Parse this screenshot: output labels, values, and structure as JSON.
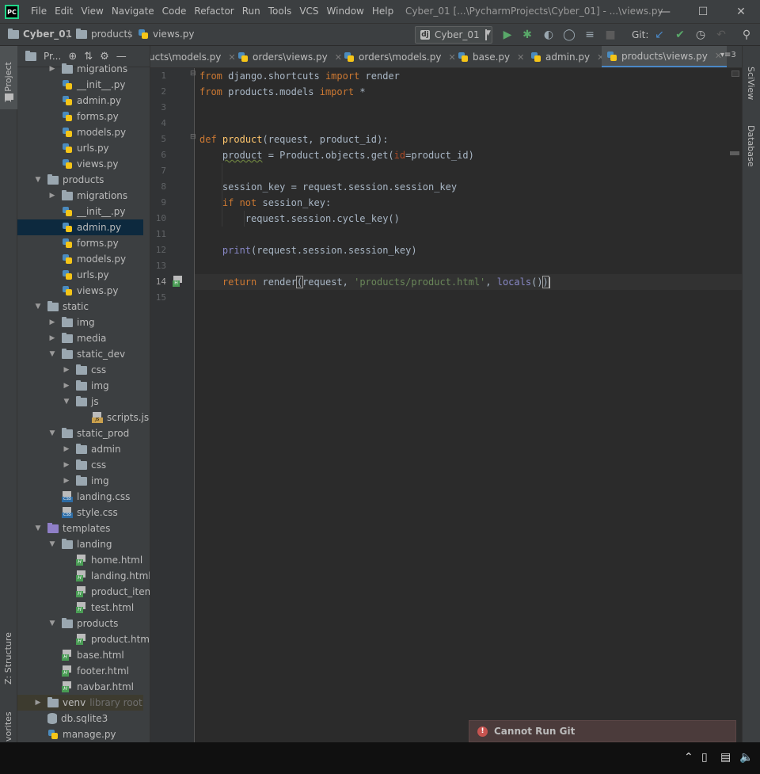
{
  "window": {
    "logo": "PC",
    "title": "Cyber_01 [...\\PycharmProjects\\Cyber_01] - ...\\views.py",
    "menu": [
      "File",
      "Edit",
      "View",
      "Navigate",
      "Code",
      "Refactor",
      "Run",
      "Tools",
      "VCS",
      "Window",
      "Help"
    ]
  },
  "navbar": {
    "breadcrumb": [
      "Cyber_01",
      "products",
      "views.py"
    ],
    "run_config": "Cyber_01",
    "run_config_icon": "dj",
    "git_label": "Git:"
  },
  "left_tools": {
    "project": "1: Project",
    "structure": "Z: Structure",
    "favorites": "vorites"
  },
  "right_tools": {
    "sciview": "SciView",
    "database": "Database"
  },
  "project_panel": {
    "title": "Pr...",
    "tree": [
      {
        "label": "migrations",
        "type": "folder",
        "depth": 1,
        "arrow": "right"
      },
      {
        "label": "__init__.py",
        "type": "py",
        "depth": 1
      },
      {
        "label": "admin.py",
        "type": "py",
        "depth": 1
      },
      {
        "label": "forms.py",
        "type": "py",
        "depth": 1
      },
      {
        "label": "models.py",
        "type": "py",
        "depth": 1
      },
      {
        "label": "urls.py",
        "type": "py",
        "depth": 1
      },
      {
        "label": "views.py",
        "type": "py",
        "depth": 1
      },
      {
        "label": "products",
        "type": "folder",
        "depth": 0,
        "arrow": "down"
      },
      {
        "label": "migrations",
        "type": "folder",
        "depth": 1,
        "arrow": "right"
      },
      {
        "label": "__init__.py",
        "type": "py",
        "depth": 1
      },
      {
        "label": "admin.py",
        "type": "py",
        "depth": 1,
        "selected": true
      },
      {
        "label": "forms.py",
        "type": "py",
        "depth": 1
      },
      {
        "label": "models.py",
        "type": "py",
        "depth": 1
      },
      {
        "label": "urls.py",
        "type": "py",
        "depth": 1
      },
      {
        "label": "views.py",
        "type": "py",
        "depth": 1
      },
      {
        "label": "static",
        "type": "folder",
        "depth": 0,
        "arrow": "down"
      },
      {
        "label": "img",
        "type": "folder",
        "depth": 1,
        "arrow": "right"
      },
      {
        "label": "media",
        "type": "folder",
        "depth": 1,
        "arrow": "right"
      },
      {
        "label": "static_dev",
        "type": "folder",
        "depth": 1,
        "arrow": "down"
      },
      {
        "label": "css",
        "type": "folder",
        "depth": 2,
        "arrow": "right"
      },
      {
        "label": "img",
        "type": "folder",
        "depth": 2,
        "arrow": "right"
      },
      {
        "label": "js",
        "type": "folder",
        "depth": 2,
        "arrow": "down"
      },
      {
        "label": "scripts.js",
        "type": "js",
        "depth": 3
      },
      {
        "label": "static_prod",
        "type": "folder",
        "depth": 1,
        "arrow": "down"
      },
      {
        "label": "admin",
        "type": "folder",
        "depth": 2,
        "arrow": "right"
      },
      {
        "label": "css",
        "type": "folder",
        "depth": 2,
        "arrow": "right"
      },
      {
        "label": "img",
        "type": "folder",
        "depth": 2,
        "arrow": "right"
      },
      {
        "label": "landing.css",
        "type": "css",
        "depth": 1
      },
      {
        "label": "style.css",
        "type": "css",
        "depth": 1
      },
      {
        "label": "templates",
        "type": "tpl",
        "depth": 0,
        "arrow": "down"
      },
      {
        "label": "landing",
        "type": "folder",
        "depth": 1,
        "arrow": "down"
      },
      {
        "label": "home.html",
        "type": "html",
        "depth": 2
      },
      {
        "label": "landing.html",
        "type": "html",
        "depth": 2
      },
      {
        "label": "product_item.html",
        "type": "html",
        "depth": 2
      },
      {
        "label": "test.html",
        "type": "html",
        "depth": 2
      },
      {
        "label": "products",
        "type": "folder",
        "depth": 1,
        "arrow": "down"
      },
      {
        "label": "product.html",
        "type": "html",
        "depth": 2
      },
      {
        "label": "base.html",
        "type": "html",
        "depth": 1
      },
      {
        "label": "footer.html",
        "type": "html",
        "depth": 1
      },
      {
        "label": "navbar.html",
        "type": "html",
        "depth": 1
      },
      {
        "label": "venv",
        "type": "folder",
        "depth": 0,
        "arrow": "right",
        "extra": "library root",
        "lib": true
      },
      {
        "label": "db.sqlite3",
        "type": "db",
        "depth": 0
      },
      {
        "label": "manage.py",
        "type": "py",
        "depth": 0
      }
    ]
  },
  "tabs": [
    {
      "label": "ucts\\models.py",
      "icon": "none"
    },
    {
      "label": "orders\\views.py",
      "icon": "py"
    },
    {
      "label": "orders\\models.py",
      "icon": "py"
    },
    {
      "label": "base.py",
      "icon": "py"
    },
    {
      "label": "admin.py",
      "icon": "py"
    },
    {
      "label": "products\\views.py",
      "icon": "py",
      "active": true
    }
  ],
  "tab_overflow": "▾≡3",
  "editor": {
    "line_numbers": [
      "1",
      "2",
      "3",
      "4",
      "5",
      "6",
      "7",
      "8",
      "9",
      "10",
      "11",
      "12",
      "13",
      "14",
      "15"
    ],
    "current_line": "14"
  },
  "notification": {
    "text": "Cannot Run Git",
    "icon": "error-icon"
  },
  "colors": {
    "accent": "#4a88c7",
    "keyword": "#cc7832",
    "function": "#ffc66d",
    "string": "#6a8759",
    "error": "#c75450"
  }
}
